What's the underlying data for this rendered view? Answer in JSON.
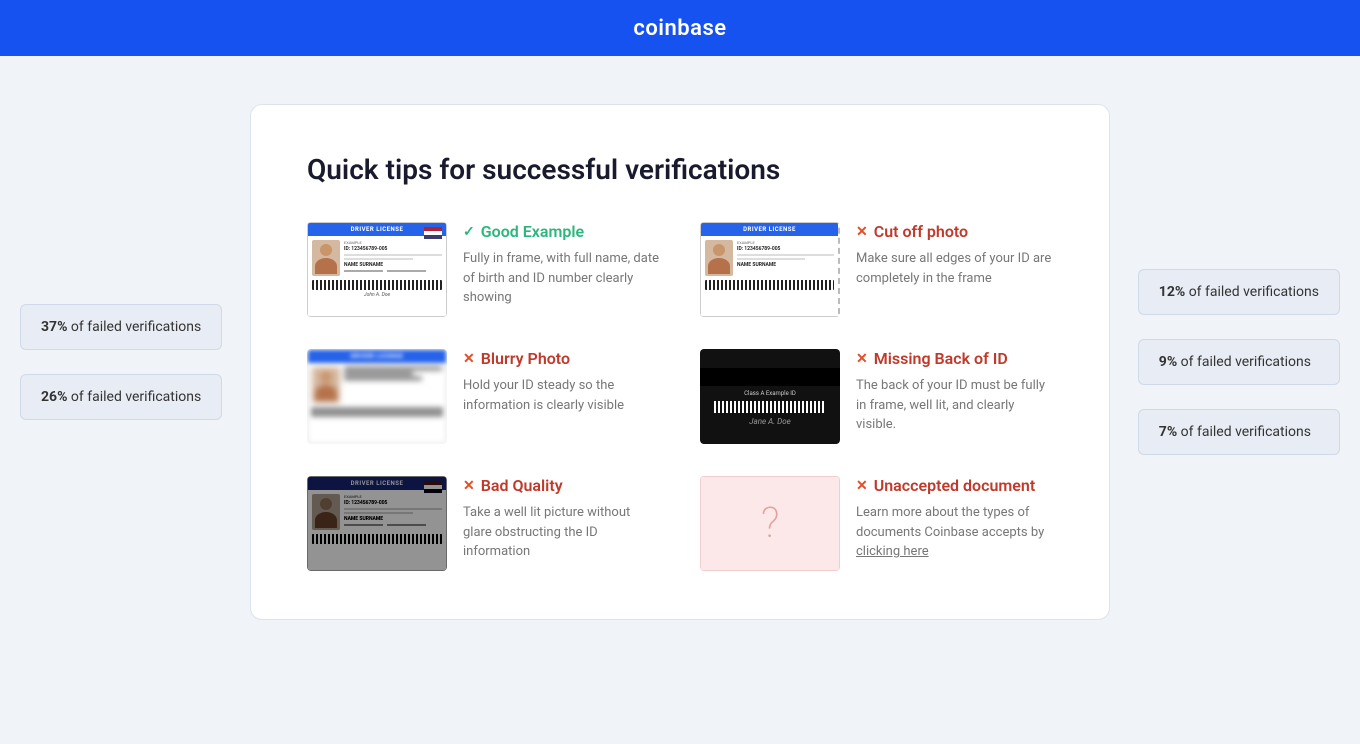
{
  "header": {
    "logo": "coinbase"
  },
  "page": {
    "title": "Quick tips for successful verifications"
  },
  "left_badges": [
    {
      "id": "badge-left-1",
      "percent": "37%",
      "label": "of failed verifications"
    },
    {
      "id": "badge-left-2",
      "percent": "26%",
      "label": "of failed verifications"
    }
  ],
  "right_badges": [
    {
      "id": "badge-right-1",
      "percent": "12%",
      "label": "of failed verifications"
    },
    {
      "id": "badge-right-2",
      "percent": "9%",
      "label": "of failed verifications"
    },
    {
      "id": "badge-right-3",
      "percent": "7%",
      "label": "of failed verifications"
    }
  ],
  "tips": [
    {
      "id": "tip-good-example",
      "type": "good",
      "icon": "✓",
      "label": "Good Example",
      "description": "Fully in frame, with full name, date of birth and ID number clearly showing",
      "image_type": "id-good"
    },
    {
      "id": "tip-cutoff-photo",
      "type": "bad",
      "icon": "✕",
      "label": "Cut off photo",
      "description": "Make sure all edges of your ID are completely in the frame",
      "image_type": "id-cutoff"
    },
    {
      "id": "tip-blurry-photo",
      "type": "bad",
      "icon": "✕",
      "label": "Blurry Photo",
      "description": "Hold your ID steady so the information is clearly visible",
      "image_type": "id-blurry"
    },
    {
      "id": "tip-missing-back",
      "type": "bad",
      "icon": "✕",
      "label": "Missing Back of ID",
      "description": "The back of your ID must be fully in frame, well lit, and clearly visible.",
      "image_type": "id-back"
    },
    {
      "id": "tip-bad-quality",
      "type": "bad",
      "icon": "✕",
      "label": "Bad Quality",
      "description": "Take a well lit picture without glare obstructing the ID information",
      "image_type": "id-bad"
    },
    {
      "id": "tip-unaccepted",
      "type": "bad",
      "icon": "✕",
      "label": "Unaccepted document",
      "description": "Learn more about the types of documents Coinbase accepts by",
      "link_text": "clicking here",
      "image_type": "id-unknown"
    }
  ],
  "id_card_text": {
    "header": "DRIVER LICENSE",
    "example_label": "EXAMPLE",
    "id_number": "ID: 123456789-005",
    "name": "NAME SURNAME",
    "back_label": "Class A Example ID"
  }
}
